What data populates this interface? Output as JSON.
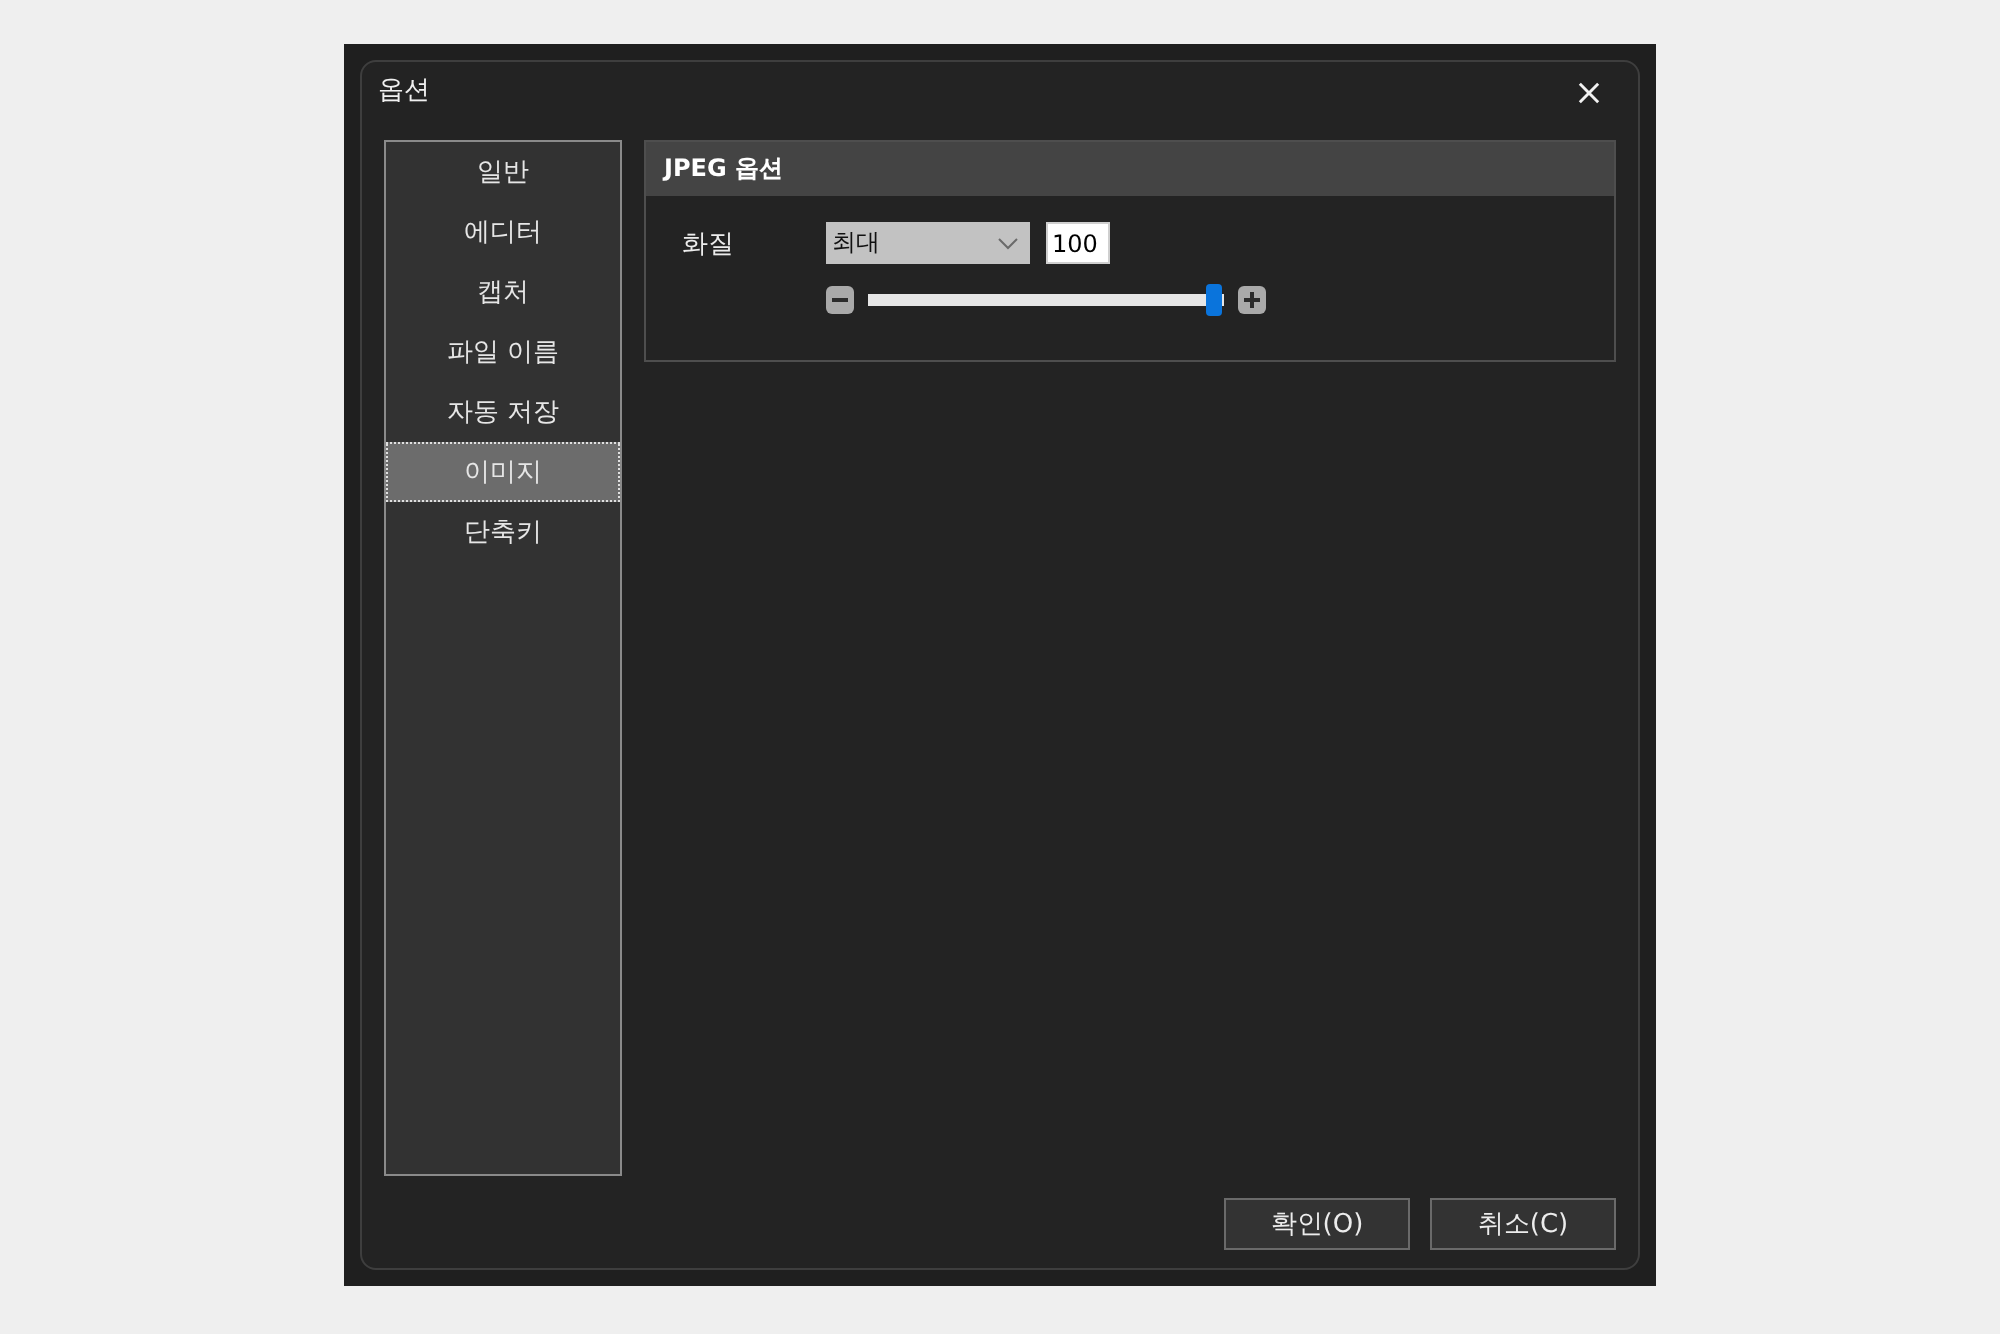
{
  "window": {
    "title": "옵션"
  },
  "sidebar": {
    "items": [
      {
        "label": "일반",
        "selected": false
      },
      {
        "label": "에디터",
        "selected": false
      },
      {
        "label": "캡처",
        "selected": false
      },
      {
        "label": "파일 이름",
        "selected": false
      },
      {
        "label": "자동 저장",
        "selected": false
      },
      {
        "label": "이미지",
        "selected": true
      },
      {
        "label": "단축키",
        "selected": false
      }
    ]
  },
  "panel": {
    "title": "JPEG 옵션",
    "quality": {
      "label": "화질",
      "preset": "최대",
      "value": "100",
      "slider": {
        "level": 1.0
      }
    }
  },
  "buttons": [
    "확인(O)",
    "취소(C)"
  ]
}
